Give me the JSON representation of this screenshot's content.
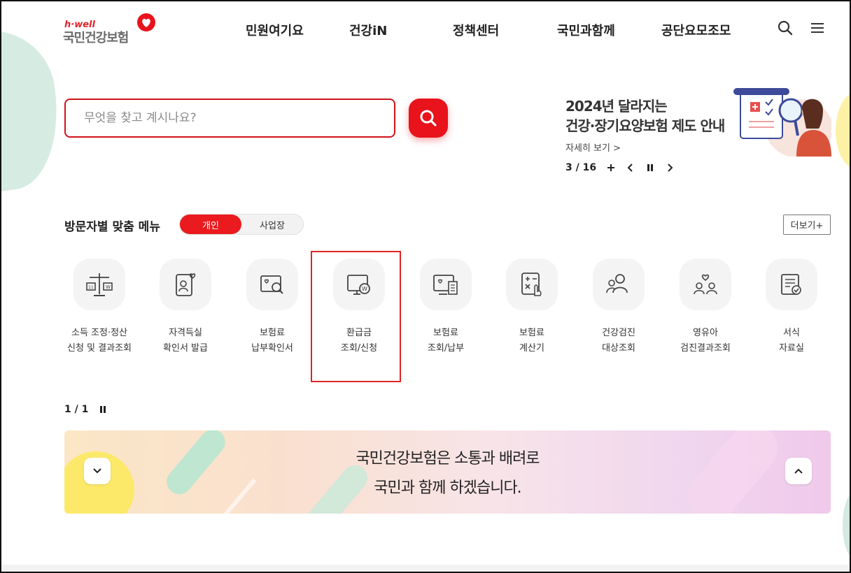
{
  "logo": {
    "small": "h·well",
    "main": "국민건강보험"
  },
  "gnb": [
    "민원여기요",
    "건강iN",
    "정책센터",
    "국민과함께",
    "공단요모조모"
  ],
  "search": {
    "placeholder": "무엇을 찾고 계시나요?"
  },
  "banner": {
    "line1": "2024년 달라지는",
    "line2": "건강·장기요양보험 제도 안내",
    "link": "자세히 보기 >",
    "pager": "3 / 16"
  },
  "visitor_menu": {
    "title": "방문자별 맞춤 메뉴",
    "tab_personal": "개인",
    "tab_business": "사업장",
    "more": "더보기+",
    "items": [
      {
        "line1": "소득 조정·정산",
        "line2": "신청 및 결과조회",
        "icon": "scale-icon"
      },
      {
        "line1": "자격득실",
        "line2": "확인서 발급",
        "icon": "certificate-icon"
      },
      {
        "line1": "보험료",
        "line2": "납부확인서",
        "icon": "payment-search-icon"
      },
      {
        "line1": "환급금",
        "line2": "조회/신청",
        "icon": "refund-monitor-icon"
      },
      {
        "line1": "보험료",
        "line2": "조회/납부",
        "icon": "monitor-receipt-icon"
      },
      {
        "line1": "보험료",
        "line2": "계산기",
        "icon": "calculator-icon"
      },
      {
        "line1": "건강검진",
        "line2": "대상조회",
        "icon": "people-search-icon"
      },
      {
        "line1": "영유아",
        "line2": "검진결과조회",
        "icon": "family-icon"
      },
      {
        "line1": "서식",
        "line2": "자료실",
        "icon": "document-icon"
      }
    ],
    "pager": "1 / 1"
  },
  "bottom_banner": {
    "line1": "국민건강보험은 소통과 배려로",
    "line2": "국민과 함께 하겠습니다."
  },
  "colors": {
    "brand_red": "#e8131b",
    "highlight": "#e02424"
  }
}
